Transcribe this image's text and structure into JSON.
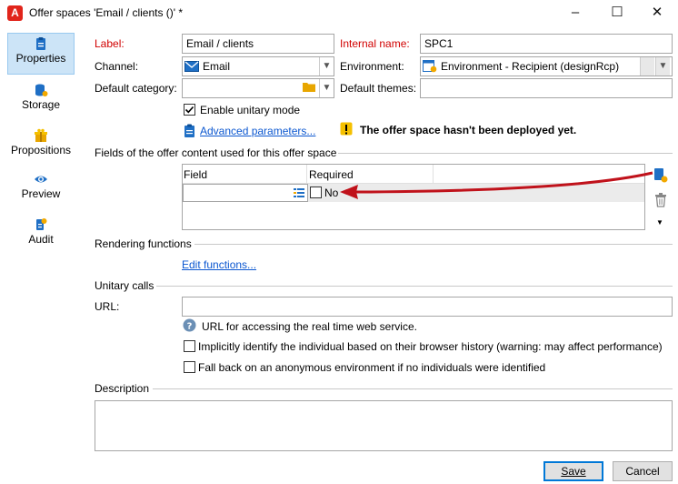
{
  "window": {
    "title": "Offer spaces 'Email / clients ()' *",
    "app_icon": "A",
    "minimize": "–",
    "maximize": "☐",
    "close": "✕"
  },
  "nav": [
    {
      "label": "Properties",
      "icon": "clipboard-icon"
    },
    {
      "label": "Storage",
      "icon": "database-icon"
    },
    {
      "label": "Propositions",
      "icon": "gift-icon"
    },
    {
      "label": "Preview",
      "icon": "eye-icon"
    },
    {
      "label": "Audit",
      "icon": "audit-icon"
    }
  ],
  "form": {
    "label_caption": "Label:",
    "label_value": "Email / clients",
    "internal_name_caption": "Internal name:",
    "internal_name_value": "SPC1",
    "channel_caption": "Channel:",
    "channel_value": "Email",
    "environment_caption": "Environment:",
    "environment_value": "Environment - Recipient (designRcp)",
    "default_category_caption": "Default category:",
    "default_category_value": "",
    "default_themes_caption": "Default themes:",
    "default_themes_value": "",
    "unitary_mode_label": "Enable unitary mode",
    "advanced_params_link": "Advanced parameters...",
    "warning_text": "The offer space hasn't been deployed yet."
  },
  "fields_section": {
    "title": "Fields of the offer content used for this offer space",
    "col_field": "Field",
    "col_required": "Required",
    "row_required_value": "No"
  },
  "rendering": {
    "title": "Rendering functions",
    "edit_link": "Edit functions..."
  },
  "unitary_calls": {
    "title": "Unitary calls",
    "url_caption": "URL:",
    "url_value": "",
    "url_help": "URL for accessing the real time web service.",
    "implicit_label": "Implicitly identify the individual based on their browser history (warning: may affect performance)",
    "fallback_label": "Fall back on an anonymous environment if no individuals were identified"
  },
  "description": {
    "title": "Description",
    "value": ""
  },
  "buttons": {
    "save": "Save",
    "cancel": "Cancel"
  },
  "colors": {
    "accent": "#0078d7",
    "required_label": "#d10000",
    "arrow": "#c0121b",
    "nav_active": "#cce4f7"
  }
}
